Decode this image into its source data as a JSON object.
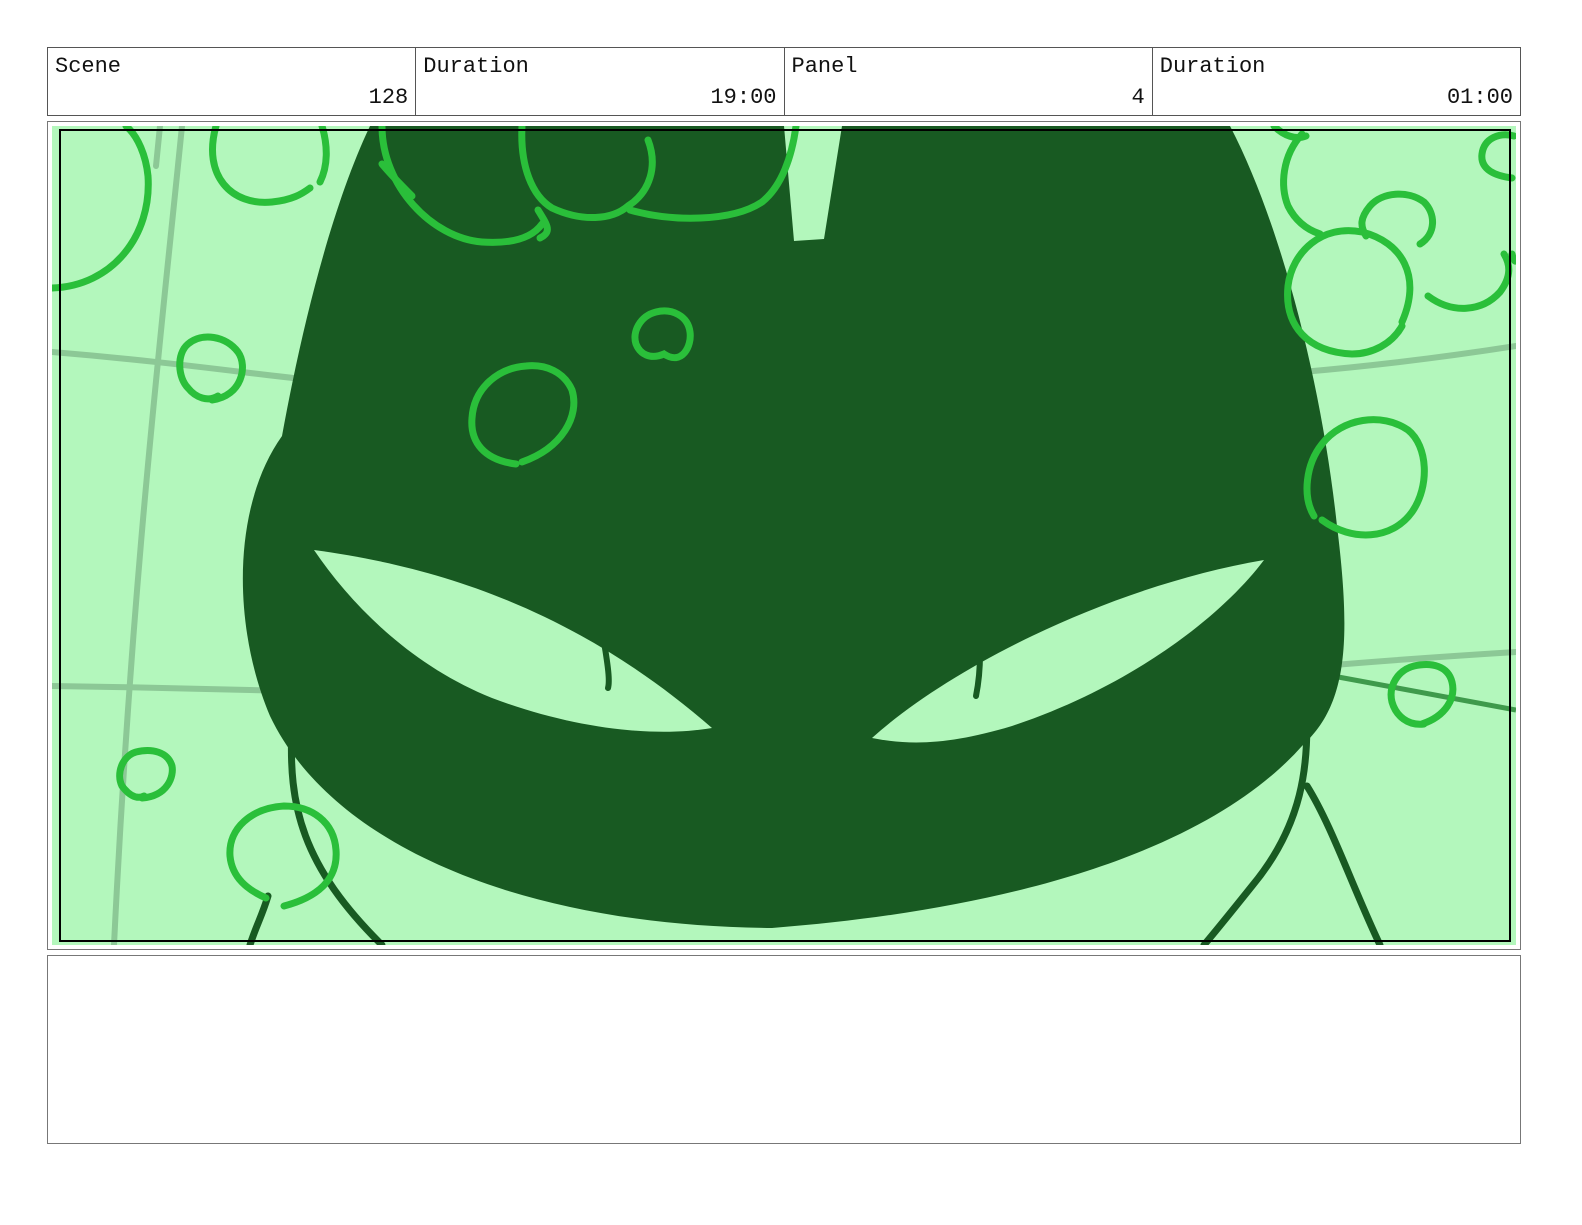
{
  "header": {
    "scene_label": "Scene",
    "scene_value": "128",
    "scene_duration_label": "Duration",
    "scene_duration_value": "19:00",
    "panel_label": "Panel",
    "panel_value": "4",
    "panel_duration_label": "Duration",
    "panel_duration_value": "01:00"
  },
  "colors": {
    "background_light": "#b3f7bc",
    "silhouette_dark": "#185a22",
    "bubble_green": "#2abf3a",
    "grid_line": "#8cc896",
    "frame_line": "#000000"
  },
  "notes": {
    "text": ""
  }
}
